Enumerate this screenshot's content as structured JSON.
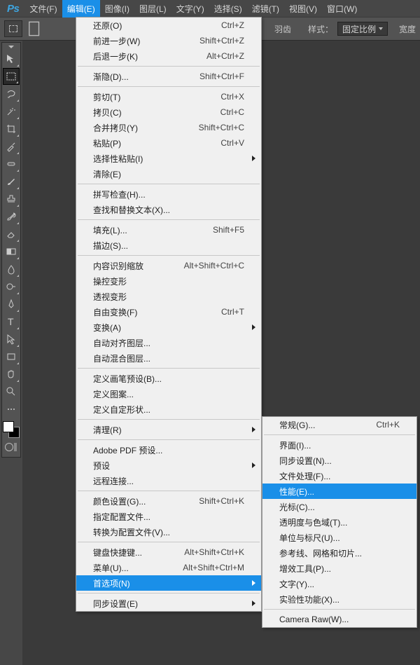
{
  "app": {
    "logo": "Ps"
  },
  "menubar": [
    {
      "label": "文件(F)"
    },
    {
      "label": "编辑(E)"
    },
    {
      "label": "图像(I)"
    },
    {
      "label": "图层(L)"
    },
    {
      "label": "文字(Y)"
    },
    {
      "label": "选择(S)"
    },
    {
      "label": "滤镜(T)"
    },
    {
      "label": "视图(V)"
    },
    {
      "label": "窗口(W)"
    }
  ],
  "optionsbar": {
    "feather_label": "羽齿",
    "style_label": "样式：",
    "style_value": "固定比例",
    "width_label": "宽度"
  },
  "edit_menu": [
    {
      "t": "item",
      "label": "还原(O)",
      "sc": "Ctrl+Z"
    },
    {
      "t": "item",
      "label": "前进一步(W)",
      "sc": "Shift+Ctrl+Z"
    },
    {
      "t": "item",
      "label": "后退一步(K)",
      "sc": "Alt+Ctrl+Z"
    },
    {
      "t": "sep"
    },
    {
      "t": "item",
      "label": "渐隐(D)...",
      "sc": "Shift+Ctrl+F"
    },
    {
      "t": "sep"
    },
    {
      "t": "item",
      "label": "剪切(T)",
      "sc": "Ctrl+X"
    },
    {
      "t": "item",
      "label": "拷贝(C)",
      "sc": "Ctrl+C"
    },
    {
      "t": "item",
      "label": "合并拷贝(Y)",
      "sc": "Shift+Ctrl+C"
    },
    {
      "t": "item",
      "label": "粘贴(P)",
      "sc": "Ctrl+V"
    },
    {
      "t": "item",
      "label": "选择性粘贴(I)",
      "sub": true
    },
    {
      "t": "item",
      "label": "清除(E)"
    },
    {
      "t": "sep"
    },
    {
      "t": "item",
      "label": "拼写检查(H)..."
    },
    {
      "t": "item",
      "label": "查找和替换文本(X)..."
    },
    {
      "t": "sep"
    },
    {
      "t": "item",
      "label": "填充(L)...",
      "sc": "Shift+F5"
    },
    {
      "t": "item",
      "label": "描边(S)..."
    },
    {
      "t": "sep"
    },
    {
      "t": "item",
      "label": "内容识别缩放",
      "sc": "Alt+Shift+Ctrl+C"
    },
    {
      "t": "item",
      "label": "操控变形"
    },
    {
      "t": "item",
      "label": "透视变形"
    },
    {
      "t": "item",
      "label": "自由变换(F)",
      "sc": "Ctrl+T"
    },
    {
      "t": "item",
      "label": "变换(A)",
      "sub": true
    },
    {
      "t": "item",
      "label": "自动对齐图层..."
    },
    {
      "t": "item",
      "label": "自动混合图层..."
    },
    {
      "t": "sep"
    },
    {
      "t": "item",
      "label": "定义画笔预设(B)..."
    },
    {
      "t": "item",
      "label": "定义图案..."
    },
    {
      "t": "item",
      "label": "定义自定形状..."
    },
    {
      "t": "sep"
    },
    {
      "t": "item",
      "label": "清理(R)",
      "sub": true
    },
    {
      "t": "sep"
    },
    {
      "t": "item",
      "label": "Adobe PDF 预设..."
    },
    {
      "t": "item",
      "label": "预设",
      "sub": true
    },
    {
      "t": "item",
      "label": "远程连接..."
    },
    {
      "t": "sep"
    },
    {
      "t": "item",
      "label": "颜色设置(G)...",
      "sc": "Shift+Ctrl+K"
    },
    {
      "t": "item",
      "label": "指定配置文件..."
    },
    {
      "t": "item",
      "label": "转换为配置文件(V)..."
    },
    {
      "t": "sep"
    },
    {
      "t": "item",
      "label": "键盘快捷键...",
      "sc": "Alt+Shift+Ctrl+K"
    },
    {
      "t": "item",
      "label": "菜单(U)...",
      "sc": "Alt+Shift+Ctrl+M"
    },
    {
      "t": "item",
      "label": "首选项(N)",
      "sub": true,
      "hl": true
    },
    {
      "t": "sep"
    },
    {
      "t": "item",
      "label": "同步设置(E)",
      "sub": true
    }
  ],
  "prefs_submenu": [
    {
      "t": "item",
      "label": "常规(G)...",
      "sc": "Ctrl+K"
    },
    {
      "t": "sep"
    },
    {
      "t": "item",
      "label": "界面(I)..."
    },
    {
      "t": "item",
      "label": "同步设置(N)..."
    },
    {
      "t": "item",
      "label": "文件处理(F)..."
    },
    {
      "t": "item",
      "label": "性能(E)...",
      "hl": true
    },
    {
      "t": "item",
      "label": "光标(C)..."
    },
    {
      "t": "item",
      "label": "透明度与色域(T)..."
    },
    {
      "t": "item",
      "label": "单位与标尺(U)..."
    },
    {
      "t": "item",
      "label": "参考线、网格和切片..."
    },
    {
      "t": "item",
      "label": "增效工具(P)..."
    },
    {
      "t": "item",
      "label": "文字(Y)..."
    },
    {
      "t": "item",
      "label": "实验性功能(X)..."
    },
    {
      "t": "sep"
    },
    {
      "t": "item",
      "label": "Camera Raw(W)..."
    }
  ],
  "tools": [
    "move",
    "marquee",
    "lasso",
    "wand",
    "crop",
    "eyedropper",
    "healing",
    "brush",
    "stamp",
    "history-brush",
    "eraser",
    "gradient",
    "blur",
    "dodge",
    "pen",
    "type",
    "path-select",
    "rectangle",
    "hand",
    "zoom",
    "edit-toolbar"
  ]
}
